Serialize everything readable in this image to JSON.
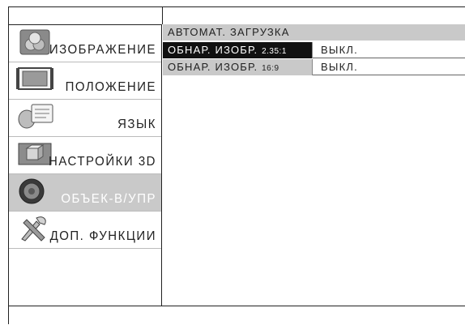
{
  "sidebar": {
    "items": [
      {
        "label": "ИЗОБРАЖЕНИЕ",
        "icon": "picture-icon",
        "active": false
      },
      {
        "label": "ПОЛОЖЕНИЕ",
        "icon": "position-icon",
        "active": false
      },
      {
        "label": "ЯЗЫК",
        "icon": "language-icon",
        "active": false
      },
      {
        "label": "НАСТРОЙКИ 3D",
        "icon": "3d-settings-icon",
        "active": false
      },
      {
        "label": "ОБЪЕК-В/УПР",
        "icon": "lens-control-icon",
        "active": true
      },
      {
        "label": "ДОП. ФУНКЦИИ",
        "icon": "tools-icon",
        "active": false
      }
    ]
  },
  "content": {
    "header": "АВТОМАТ. ЗАГРУЗКА",
    "rows": [
      {
        "label_main": "ОБНАР. ИЗОБР. ",
        "label_small": "2.35:1",
        "value": "ВЫКЛ."
      },
      {
        "label_main": "ОБНАР. ИЗОБР. ",
        "label_small": "16:9",
        "value": "ВЫКЛ."
      }
    ]
  }
}
